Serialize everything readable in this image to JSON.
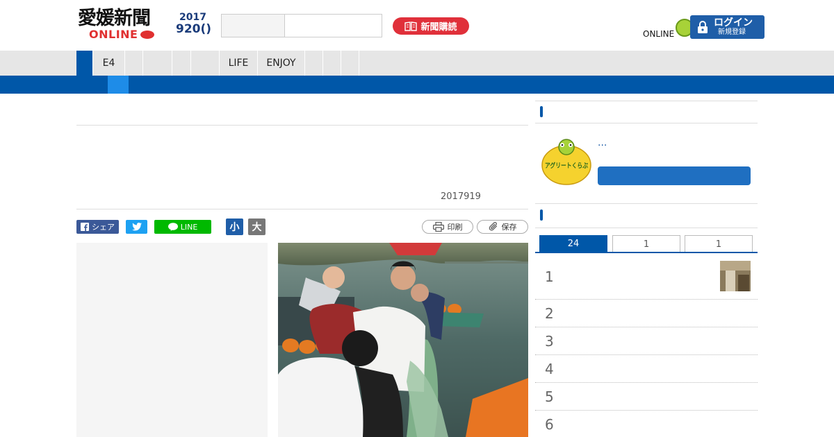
{
  "header": {
    "logo_main": "愛媛新聞",
    "logo_sub": "ONLINE",
    "date_year": "2017",
    "date_day": "920()",
    "subscribe_label": "新聞購読",
    "online_label": "ONLINE",
    "login_label": "ログイン",
    "register_label": "新規登録"
  },
  "nav": {
    "items": [
      "",
      "E4",
      "",
      "",
      "",
      "",
      "LIFE",
      "ENJOY",
      "",
      "",
      ""
    ]
  },
  "article": {
    "date": "2017919",
    "share": {
      "facebook_label": "シェア",
      "line_label": "LINE"
    },
    "font_small_label": "小",
    "font_large_label": "大",
    "print_label": "印刷",
    "save_label": "保存"
  },
  "sidebar": {
    "agri_logo_text": "アグリートくらぶ",
    "agri_title": "...",
    "ranking_tabs": [
      "24",
      "1",
      "1"
    ],
    "ranking_numbers": [
      "1",
      "2",
      "3",
      "4",
      "5",
      "6"
    ]
  },
  "colors": {
    "brand_blue": "#0057a8",
    "subnav_active": "#1e8ce8",
    "subscribe_red": "#e0303a",
    "facebook": "#3b5998",
    "twitter": "#1da1f2",
    "line": "#00b900"
  },
  "icons": [
    "book-icon",
    "lock-icon",
    "facebook-icon",
    "twitter-icon",
    "line-icon",
    "print-icon",
    "paperclip-icon"
  ]
}
